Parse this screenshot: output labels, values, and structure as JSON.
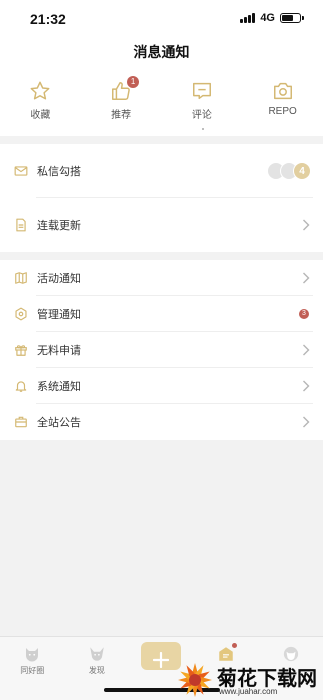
{
  "status_bar": {
    "time": "21:32",
    "network": "4G"
  },
  "header": {
    "title": "消息通知"
  },
  "quick_actions": [
    {
      "label": "收藏",
      "icon": "star-icon"
    },
    {
      "label": "推荐",
      "icon": "thumbs-up-icon",
      "badge": "1"
    },
    {
      "label": "评论",
      "icon": "comment-icon"
    },
    {
      "label": "REPO",
      "icon": "camera-icon"
    }
  ],
  "section1": {
    "rows": [
      {
        "label": "私信勾搭",
        "icon": "mail-icon",
        "count": "4"
      },
      {
        "label": "连载更新",
        "icon": "document-icon"
      }
    ]
  },
  "section2": {
    "rows": [
      {
        "label": "活动通知",
        "icon": "map-icon"
      },
      {
        "label": "管理通知",
        "icon": "hexagon-settings-icon",
        "badge": "3"
      },
      {
        "label": "无料申请",
        "icon": "gift-icon"
      },
      {
        "label": "系统通知",
        "icon": "bell-icon"
      },
      {
        "label": "全站公告",
        "icon": "briefcase-icon"
      }
    ]
  },
  "tabbar": [
    {
      "label": "同好圈",
      "icon": "cat-icon"
    },
    {
      "label": "发现",
      "icon": "fox-icon"
    },
    {
      "label": "",
      "icon": "plus-icon"
    },
    {
      "label": "",
      "icon": "message-icon"
    },
    {
      "label": "",
      "icon": "profile-icon"
    }
  ],
  "watermark": {
    "title": "菊花下载网",
    "url": "www.juahar.com"
  },
  "colors": {
    "accent": "#d4b872",
    "badge": "#c15e55",
    "background": "#f2f2f2"
  }
}
